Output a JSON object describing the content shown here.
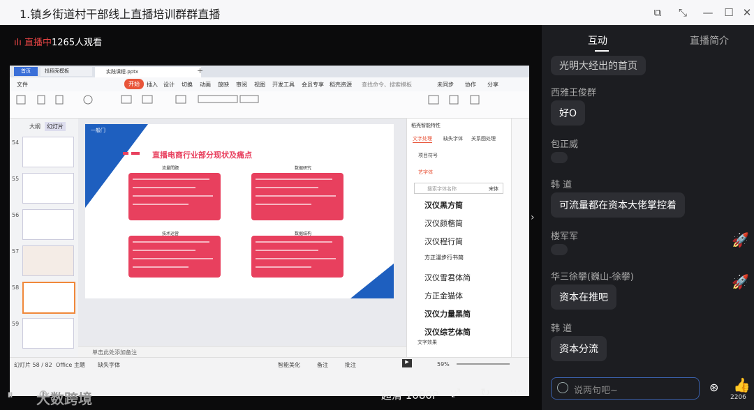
{
  "window": {
    "title": "1.镇乡街道村干部线上直播培训群群直播"
  },
  "player": {
    "live_label": "直播中",
    "viewers": "1265人观看",
    "quality": "超清 1080P",
    "watermark": "大数跨境"
  },
  "ppt": {
    "tab_home": "首页",
    "tab_template": "找稻壳模板",
    "tab_file": "实践课程.pptx",
    "menu": [
      "文件",
      "开始",
      "插入",
      "设计",
      "切换",
      "动画",
      "放映",
      "审阅",
      "视图",
      "开发工具",
      "会员专享",
      "稻壳资源"
    ],
    "menu_search": "查找命令、搜索模板",
    "menu_right": [
      "未同步",
      "协作",
      "分享"
    ],
    "left_tabs": [
      "大纲",
      "幻灯片"
    ],
    "thumb_numbers": [
      "54",
      "55",
      "56",
      "57",
      "58",
      "59"
    ],
    "slide_title": "直播电商行业部分现状及痛点",
    "card_titles": [
      "流量問題",
      "数据研究",
      "技术运营",
      "数据结构"
    ],
    "logo_text": "一般门",
    "notes_placeholder": "单击此处添加备注",
    "status_left": "幻灯片 58 / 82",
    "status_theme": "Office 主题",
    "status_font": "缺失字体",
    "status_items": [
      "智能美化",
      "备注",
      "批注"
    ],
    "zoom": "59%",
    "right_panel_title": "稻壳智能特性",
    "right_tabs": [
      "文字处理",
      "缺失字体",
      "关系图处理"
    ],
    "right_items": [
      "项目符号",
      "艺字体"
    ],
    "font_search": "搜索字体名称",
    "font_search_btn": "宋体",
    "font_samples": [
      "汉仪黑方简",
      "汉仪颜楷简",
      "汉仪程行简",
      "方正漫步行书简",
      "汉仪雪君体简",
      "方正金猫体",
      "汉仪力量黑简",
      "汉仪综艺体简"
    ],
    "right_bottom": "文字效果"
  },
  "sidebar": {
    "tab_interact": "互动",
    "tab_intro": "直播简介",
    "messages": [
      {
        "name": "",
        "text": "光明大经出的首页"
      },
      {
        "name": "西雅王俊群",
        "text": "好O"
      },
      {
        "name": "包正威",
        "text": ""
      },
      {
        "name": "韩 道",
        "text": "可流量都在资本大佬掌控着"
      },
      {
        "name": "楼军军",
        "text": ""
      },
      {
        "name": "华三徐攀(巍山-徐攀)",
        "text": "资本在推吧"
      },
      {
        "name": "韩 道",
        "text": "资本分流"
      }
    ],
    "input_placeholder": "说两句吧~",
    "like_count": "2206"
  },
  "colors": {
    "accent_red": "#e84545",
    "card_pink": "#e8405e",
    "slide_blue": "#1e5fbf"
  }
}
